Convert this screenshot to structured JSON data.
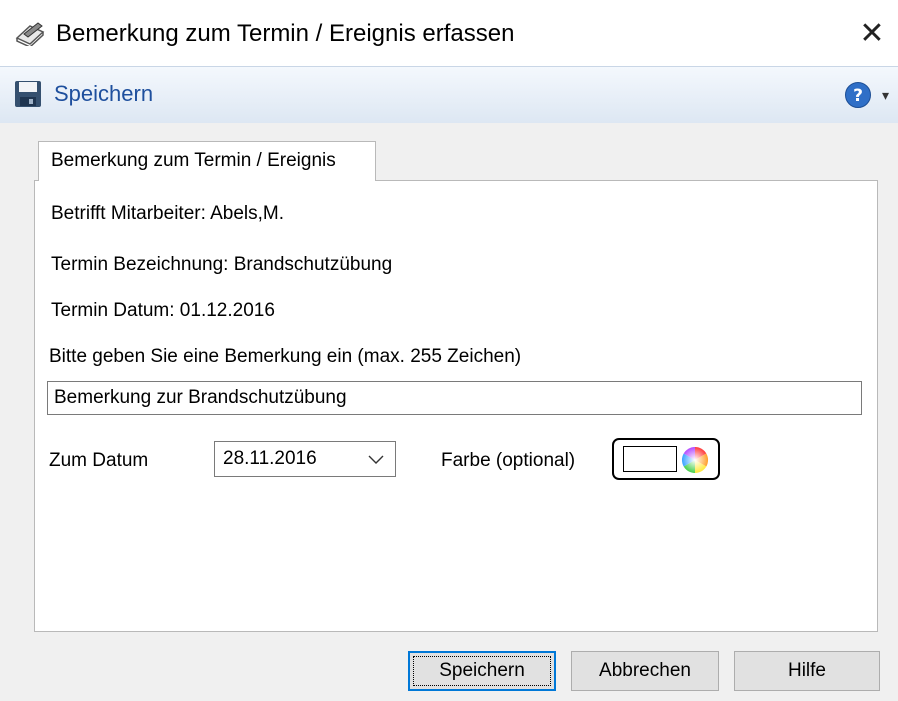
{
  "window": {
    "title": "Bemerkung zum Termin / Ereignis erfassen",
    "close_glyph": "✕",
    "icon": "note-pencil-icon"
  },
  "toolbar": {
    "save_label": "Speichern",
    "save_icon": "floppy-disk-icon",
    "help_icon": "help-icon",
    "help_dropdown_glyph": "▾"
  },
  "tab": {
    "label": "Bemerkung zum Termin / Ereignis"
  },
  "info": {
    "employee": "Betrifft Mitarbeiter: Abels,M.",
    "appointment_name": "Termin Bezeichnung: Brandschutzübung",
    "appointment_date": "Termin Datum: 01.12.2016"
  },
  "remark": {
    "prompt": "Bitte geben Sie eine Bemerkung ein (max. 255 Zeichen)",
    "value": "Bemerkung zur Brandschutzübung"
  },
  "date": {
    "label": "Zum Datum",
    "value": "28.11.2016"
  },
  "color": {
    "label": "Farbe (optional)",
    "swatch_color": "#ffffff"
  },
  "buttons": {
    "save": "Speichern",
    "cancel": "Abbrechen",
    "help": "Hilfe"
  },
  "colors": {
    "toolbar_text": "#1e4f9d",
    "default_button_border": "#0078d7"
  }
}
